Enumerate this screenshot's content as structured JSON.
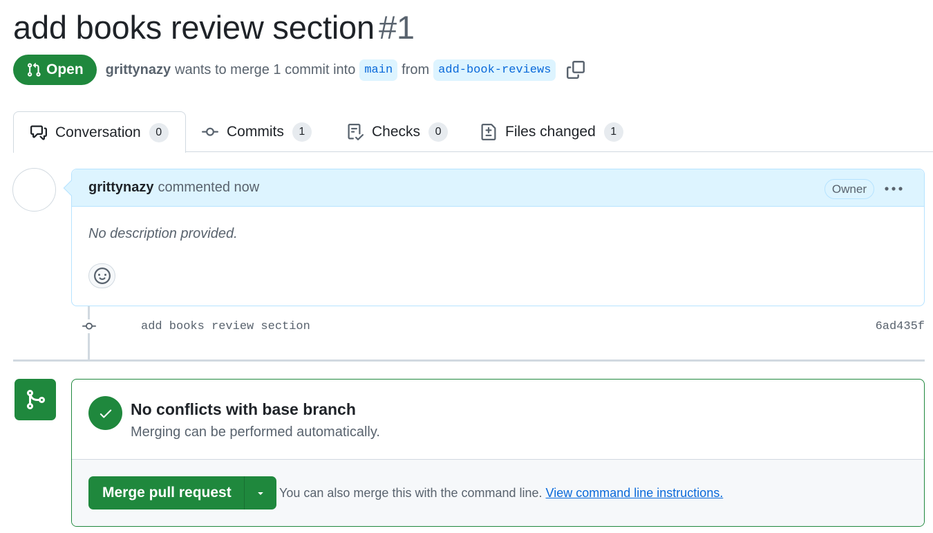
{
  "pr": {
    "title": "add books review section",
    "number": "#1",
    "state": "Open",
    "author": "grittynazy",
    "merge_text": "wants to merge 1 commit into",
    "base_branch": "main",
    "from_text": "from",
    "head_branch": "add-book-reviews"
  },
  "tabs": [
    {
      "label": "Conversation",
      "count": "0",
      "icon": "comment-discussion-icon"
    },
    {
      "label": "Commits",
      "count": "1",
      "icon": "git-commit-icon"
    },
    {
      "label": "Checks",
      "count": "0",
      "icon": "checklist-icon"
    },
    {
      "label": "Files changed",
      "count": "1",
      "icon": "file-diff-icon"
    }
  ],
  "comment": {
    "author": "grittynazy",
    "action": "commented now",
    "role": "Owner",
    "body": "No description provided."
  },
  "commit": {
    "message": "add books review section",
    "sha": "6ad435f"
  },
  "merge": {
    "status_title": "No conflicts with base branch",
    "status_subtitle": "Merging can be performed automatically.",
    "button_label": "Merge pull request",
    "hint_text": "You can also merge this with the command line.",
    "hint_link": "View command line instructions."
  },
  "colors": {
    "accent_green": "#1f883d",
    "link_blue": "#0969da",
    "comment_header_bg": "#ddf4ff"
  }
}
